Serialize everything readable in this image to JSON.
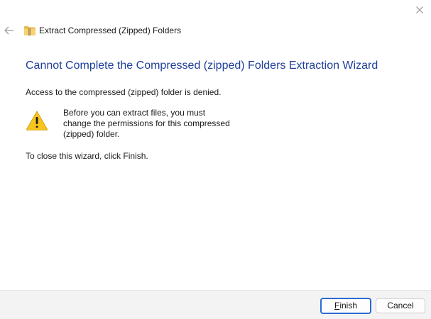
{
  "window": {
    "close_icon": "close-icon"
  },
  "header": {
    "back_icon": "back-arrow-icon",
    "app_icon": "zip-folder-icon",
    "title": "Extract Compressed (Zipped) Folders"
  },
  "content": {
    "heading": "Cannot Complete the Compressed (zipped) Folders Extraction Wizard",
    "message": "Access to the compressed (zipped) folder is denied.",
    "warning_icon": "warning-icon",
    "warning_lines": [
      "Before you can extract files, you must",
      "change the permissions for this compressed",
      "(zipped) folder."
    ],
    "instruction": "To close this wizard, click Finish."
  },
  "footer": {
    "finish_accel": "F",
    "finish_rest": "inish",
    "cancel_label": "Cancel"
  },
  "colors": {
    "heading": "#1f3f99",
    "accent": "#2c6bd3",
    "footer_bg": "#f3f3f3",
    "warning": "#f7c51c"
  }
}
